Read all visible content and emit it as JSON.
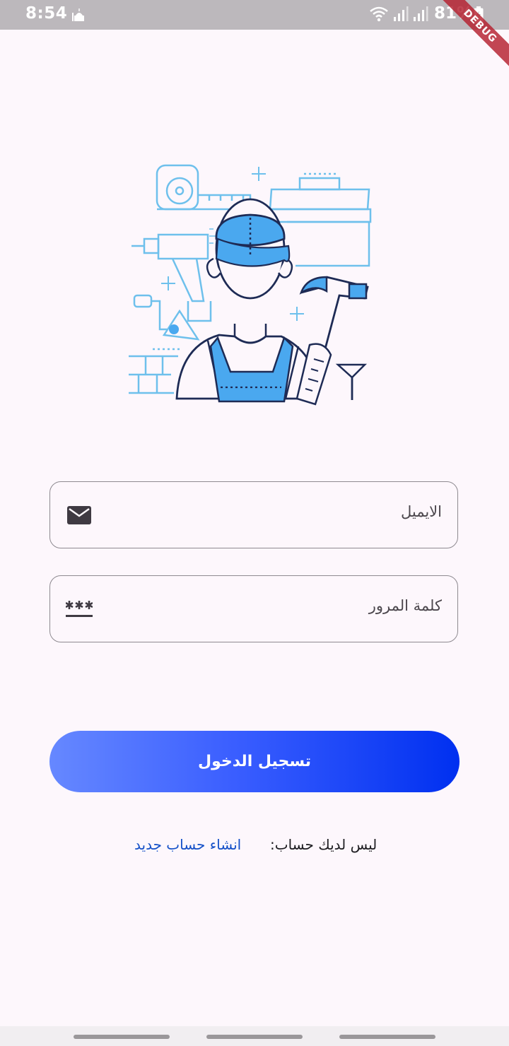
{
  "status_bar": {
    "time": "8:54",
    "battery_percent": "81%",
    "debug_badge": "DEBUG",
    "icons": [
      "mosque-icon",
      "wifi-icon",
      "signal-icon",
      "signal-icon",
      "battery-charging-icon"
    ]
  },
  "illustration": {
    "icon": "handyman-worker-illustration",
    "accent_color": "#4aa8ef",
    "line_color": "#1e2b55"
  },
  "form": {
    "email": {
      "label": "الايميل",
      "icon": "email-icon"
    },
    "password": {
      "label": "كلمة المرور",
      "icon": "password-icon"
    }
  },
  "login_button": {
    "label": "تسجيل الدخول",
    "gradient_start": "#6688ff",
    "gradient_end": "#0030f0"
  },
  "signup": {
    "question": "ليس لديك حساب:",
    "link": "انشاء حساب جديد",
    "link_color": "#1450c8"
  }
}
